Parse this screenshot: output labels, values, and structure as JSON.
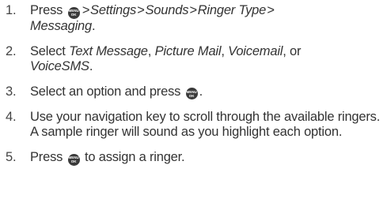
{
  "key_icon": {
    "line1": "MENU",
    "line2": "OK"
  },
  "steps": [
    {
      "num": "1.",
      "press": "Press",
      "settings": "Settings",
      "sounds": "Sounds",
      "ringer_type": "Ringer Type",
      "messaging": "Messaging",
      "end": "."
    },
    {
      "num": "2.",
      "select": "Select",
      "text_message": "Text Message",
      "comma1": ",",
      "picture_mail": "Picture Mail",
      "comma2": ",",
      "voicemail": "Voicemail",
      "or": ", or",
      "voicesms": "VoiceSMS",
      "end": "."
    },
    {
      "num": "3.",
      "text": "Select an option and press",
      "end": "."
    },
    {
      "num": "4.",
      "text": "Use your navigation key to scroll through the available ringers. A sample ringer will sound as you highlight each option."
    },
    {
      "num": "5.",
      "press": "Press",
      "text": "to assign a ringer."
    }
  ]
}
